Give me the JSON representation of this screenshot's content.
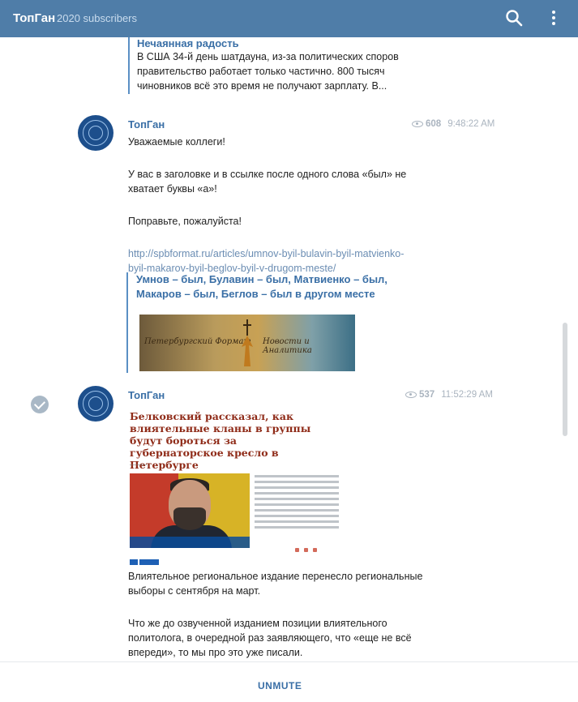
{
  "header": {
    "channel_name": "ТопГан",
    "subscribers": "2020 subscribers",
    "search_icon": "search-icon",
    "menu_icon": "more-vertical-icon"
  },
  "quoted_preview": {
    "title": "Нечаянная радость",
    "lines": [
      "В США 34-й день шатдауна, из-за политических споров",
      "правительство работает только частично. 800 тысяч",
      "чиновников всё это время не получают зарплату. В..."
    ]
  },
  "messages": [
    {
      "author": "ТопГан",
      "views": "608",
      "time": "9:48:22 AM",
      "paragraphs": [
        "Уважаемые коллеги!",
        "У вас в заголовке и в ссылке после одного слова «был» не",
        "хватает буквы «а»!",
        "Поправьте, пожалуйста!"
      ],
      "link_lines": [
        "http://spbformat.ru/articles/umnov-byil-bulavin-byil-matvienko-",
        "byil-makarov-byil-beglov-byil-v-drugom-meste/"
      ],
      "preview_title_lines": [
        "Умнов – был, Булавин – был, Матвиенко – был,",
        "Макаров – был, Беглов – был в другом месте"
      ],
      "banner_left": "Петербургский Формат",
      "banner_right": "Новости и Аналитика"
    },
    {
      "author": "ТопГан",
      "views": "537",
      "time": "11:52:29 AM",
      "article_headline": "Белковский рассказал, как влиятельные кланы в группы будут бороться за губернаторское кресло в Петербурге",
      "paragraphs": [
        "Влиятельное региональное издание перенесло региональные",
        "выборы с сентября на март.",
        "Что же до озвученной изданием позиции влиятельного",
        "политолога, в очередной раз заявляющего, что «еще не всё",
        "впереди», то мы про это уже писали."
      ]
    }
  ],
  "footer": {
    "unmute_label": "UNMUTE"
  },
  "colors": {
    "header_bg": "#4f7da8",
    "accent": "#3a6fa6"
  }
}
